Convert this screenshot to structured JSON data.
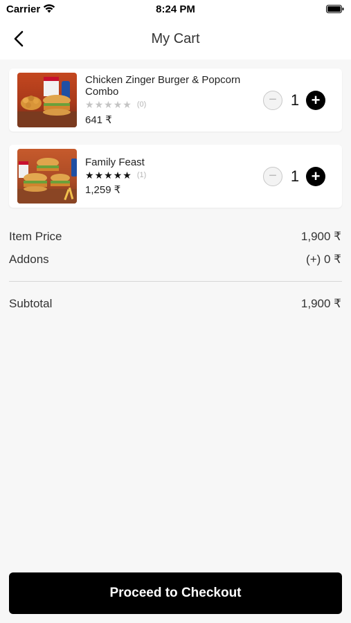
{
  "status_bar": {
    "carrier": "Carrier",
    "time": "8:24 PM",
    "wifi_icon": "wifi-icon",
    "battery_icon": "battery-icon"
  },
  "nav": {
    "title": "My Cart",
    "back_icon": "chevron-left-icon"
  },
  "cart": {
    "items": [
      {
        "name": "Chicken Zinger Burger & Popcorn Combo",
        "rating": 0,
        "rating_count": "(0)",
        "price": "641 ₹",
        "quantity": "1",
        "image": "burger-popcorn-combo-photo"
      },
      {
        "name": "Family Feast",
        "rating": 5,
        "rating_count": "(1)",
        "price": "1,259 ₹",
        "quantity": "1",
        "image": "family-feast-photo"
      }
    ],
    "minus_symbol": "−",
    "plus_symbol": "+"
  },
  "summary": {
    "item_price_label": "Item Price",
    "item_price_value": "1,900 ₹",
    "addons_label": "Addons",
    "addons_value": "(+) 0 ₹",
    "subtotal_label": "Subtotal",
    "subtotal_value": "1,900 ₹"
  },
  "checkout_button": "Proceed to Checkout",
  "colors": {
    "accent": "#000000",
    "background": "#f7f7f7",
    "card": "#ffffff",
    "star_filled": "#111111",
    "star_empty": "#c4c4c4"
  }
}
